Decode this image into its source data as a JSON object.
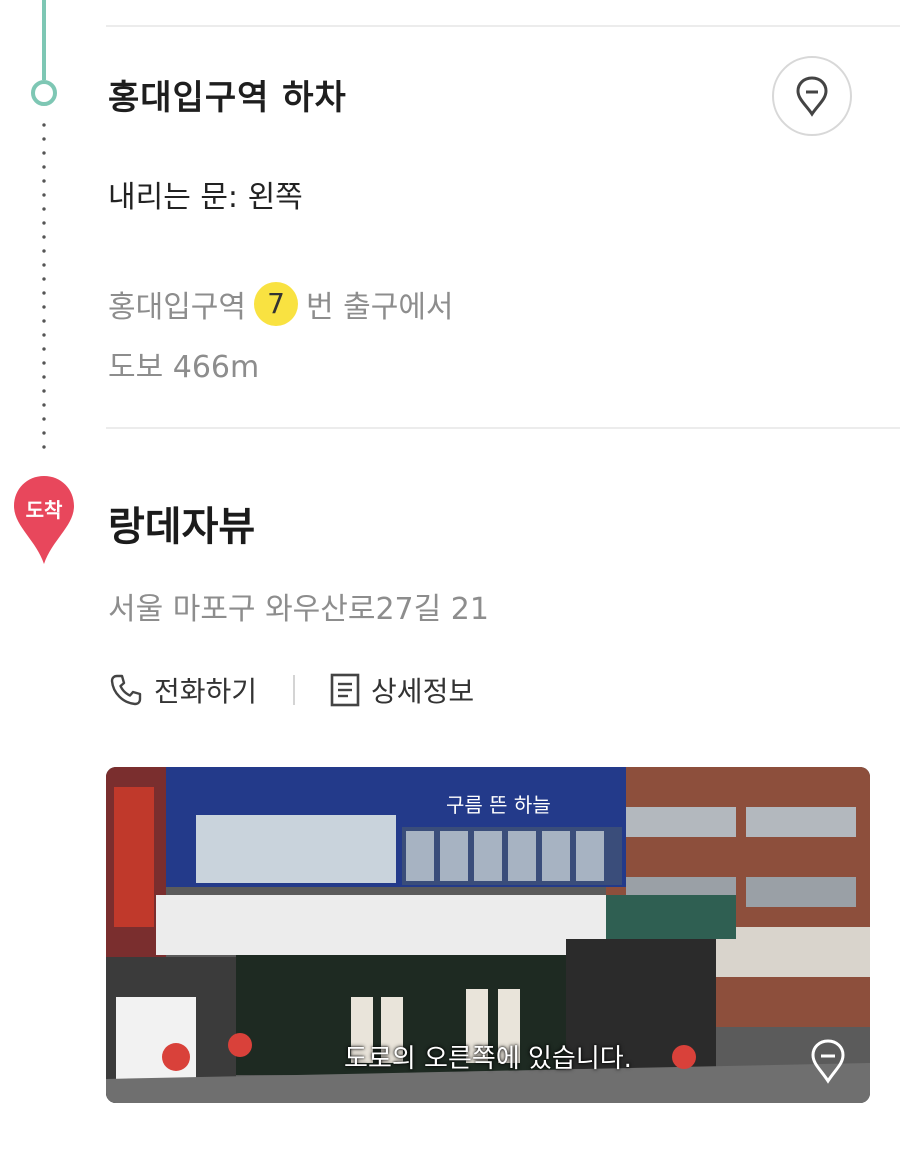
{
  "step": {
    "title": "홍대입구역 하차",
    "door": "내리는 문: 왼쪽",
    "exit_prefix": "홍대입구역",
    "exit_number": "7",
    "exit_suffix": "번 출구에서",
    "walk": "도보 466m"
  },
  "destination": {
    "badge": "도착",
    "name": "랑데자뷰",
    "address": "서울 마포구 와우산로27길 21",
    "actions": {
      "call": "전화하기",
      "detail": "상세정보"
    }
  },
  "street_view": {
    "caption": "도로의 오른쪽에 있습니다.",
    "signboard": "구름 뜬 하늘"
  },
  "colors": {
    "timeline": "#7ec7b4",
    "arrive_pin": "#e8475c",
    "exit_badge": "#f9e241"
  },
  "icons": {
    "map_button": "map-pin-icon",
    "call": "phone-icon",
    "detail": "document-icon",
    "photo_pin": "map-pin-icon"
  }
}
